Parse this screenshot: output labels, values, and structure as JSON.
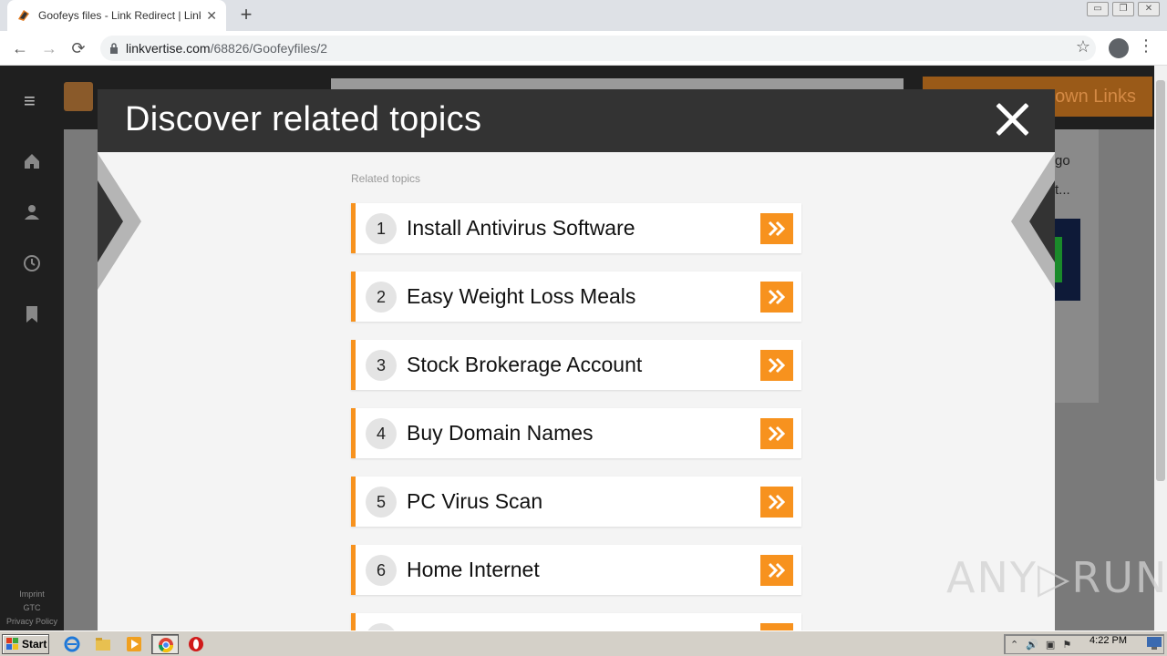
{
  "browser": {
    "tab_title": "Goofeys files - Link Redirect | Linkve",
    "tab_close": "✕",
    "new_tab": "+",
    "url_domain": "linkvertise.com",
    "url_path": "/68826/Goofeyfiles/2",
    "back": "←",
    "forward": "→",
    "reload": "⟳",
    "star": "☆",
    "menu": "⋮",
    "window_buttons": [
      "▭",
      "❐",
      "✕"
    ]
  },
  "site": {
    "header_button_text": "own Links",
    "rail_footer": [
      "Imprint",
      "GTC",
      "Privacy Policy"
    ],
    "peek_texts": [
      "go",
      "t..."
    ],
    "hamburger": "≡"
  },
  "modal": {
    "title": "Discover related topics",
    "related_label": "Related topics",
    "topics": [
      {
        "num": "1",
        "label": "Install Antivirus Software"
      },
      {
        "num": "2",
        "label": "Easy Weight Loss Meals"
      },
      {
        "num": "3",
        "label": "Stock Brokerage Account"
      },
      {
        "num": "4",
        "label": "Buy Domain Names"
      },
      {
        "num": "5",
        "label": "PC Virus Scan"
      },
      {
        "num": "6",
        "label": "Home Internet"
      },
      {
        "num": "",
        "label": ""
      }
    ],
    "accent": "#f7921e"
  },
  "watermark": "ANY▷RUN",
  "taskbar": {
    "start_label": "Start",
    "clock": "4:22 PM",
    "tray_glyphs": [
      "⌃",
      "🔊",
      "▣",
      "⚑"
    ]
  }
}
